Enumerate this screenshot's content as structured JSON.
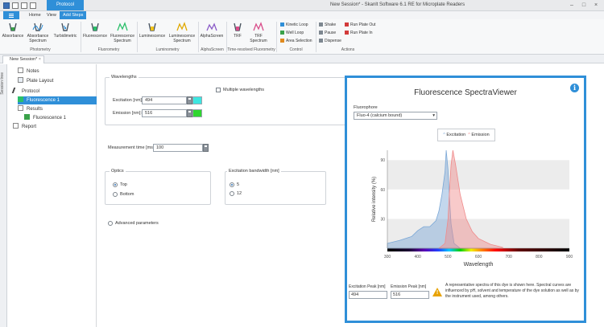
{
  "titlebar": {
    "context_tab": "Protocol",
    "title": "New Session* - Skanlt Software 6.1 RE for Microplate Readers",
    "min": "–",
    "max": "□",
    "close": "×"
  },
  "ribbon_tabs": [
    "Home",
    "View",
    "Add Steps"
  ],
  "ribbon": {
    "buttons": [
      {
        "label": "Absorbance",
        "icon": "absorbance-icon"
      },
      {
        "label": "Absorbance Spectrum",
        "icon": "absorbance-spectrum-icon"
      },
      {
        "label": "Turbidimetric",
        "icon": "turbidimetric-icon"
      },
      {
        "label": "Fluorescence",
        "icon": "fluorescence-icon"
      },
      {
        "label": "Fluorescence Spectrum",
        "icon": "fluorescence-spectrum-icon"
      },
      {
        "label": "Luminescence",
        "icon": "luminescence-icon"
      },
      {
        "label": "Luminescence Spectrum",
        "icon": "luminescence-spectrum-icon"
      },
      {
        "label": "AlphaScreen",
        "icon": "alphascreen-icon"
      },
      {
        "label": "TRF",
        "icon": "trf-icon"
      },
      {
        "label": "TRF Spectrum",
        "icon": "trf-spectrum-icon"
      }
    ],
    "control": [
      "Kinetic Loop",
      "Well Loop",
      "Area Selection"
    ],
    "actions_col1": [
      "Shake",
      "Pause",
      "Dispense"
    ],
    "actions_col2": [
      "Run Plate Out",
      "Run Plate In"
    ],
    "groups": [
      "Photometry",
      "Fluorometry",
      "Luminometry",
      "AlphaScreen",
      "Time-resolved Fluorometry",
      "Control",
      "Actions"
    ]
  },
  "doc_tab": "New Session*",
  "session_tree_label": "Session tree",
  "tree": [
    "Notes",
    "Plate Layout",
    "Protocol",
    "Fluorescence 1",
    "Results",
    "Fluorescence 1",
    "Report"
  ],
  "wavelengths": {
    "title": "Wavelengths",
    "excitation_label": "Excitation [nm]:",
    "excitation_value": "494",
    "emission_label": "Emission [nm]:",
    "emission_value": "516",
    "multiple_label": "Multiple wavelengths",
    "excitation_color": "#3de6e0",
    "emission_color": "#2fd62f"
  },
  "measurement": {
    "label": "Measurement time [ms]:",
    "value": "100"
  },
  "optics": {
    "title": "Optics",
    "top": "Top",
    "bottom": "Bottom"
  },
  "bandwidth": {
    "title": "Excitation bandwidth [nm]",
    "opt1": "5",
    "opt2": "12"
  },
  "advanced": "Advanced parameters",
  "viewer": {
    "title": "Fluorescence SpectraViewer",
    "info": "i",
    "fluorophore_label": "Fluorophore",
    "fluorophore_value": "Fluo-4 (calcium bound)",
    "legend_excitation": "Excitation",
    "legend_emission": "Emission",
    "ex_peak_label": "Excitation Peak [nm]",
    "em_peak_label": "Emission Peak [nm]",
    "ex_peak_value": "494",
    "em_peak_value": "516",
    "note": "A representative spectra of this dye is shown here. Spectral curves are influenced by pH, solvent and temperature of the dye solution as well as by the instrument used, among others."
  },
  "chart_data": {
    "type": "area",
    "xlabel": "Wavelength",
    "ylabel": "Relative intensity (%)",
    "xlim": [
      300,
      900
    ],
    "ylim": [
      0,
      100
    ],
    "x_ticks": [
      300,
      400,
      500,
      600,
      700,
      800,
      900
    ],
    "y_ticks": [
      30,
      60,
      90
    ],
    "series": [
      {
        "name": "Excitation",
        "color": "#7aa7d6",
        "x": [
          300,
          340,
          380,
          400,
          420,
          440,
          460,
          470,
          480,
          490,
          494,
          500,
          505,
          510,
          520,
          540
        ],
        "y": [
          5,
          8,
          12,
          18,
          22,
          22,
          28,
          38,
          55,
          78,
          100,
          80,
          50,
          25,
          5,
          0
        ]
      },
      {
        "name": "Emission",
        "color": "#f08a8a",
        "x": [
          470,
          490,
          500,
          505,
          510,
          516,
          525,
          540,
          560,
          580,
          600,
          640,
          680
        ],
        "y": [
          0,
          5,
          30,
          60,
          85,
          100,
          85,
          55,
          30,
          17,
          10,
          4,
          1
        ]
      }
    ]
  }
}
